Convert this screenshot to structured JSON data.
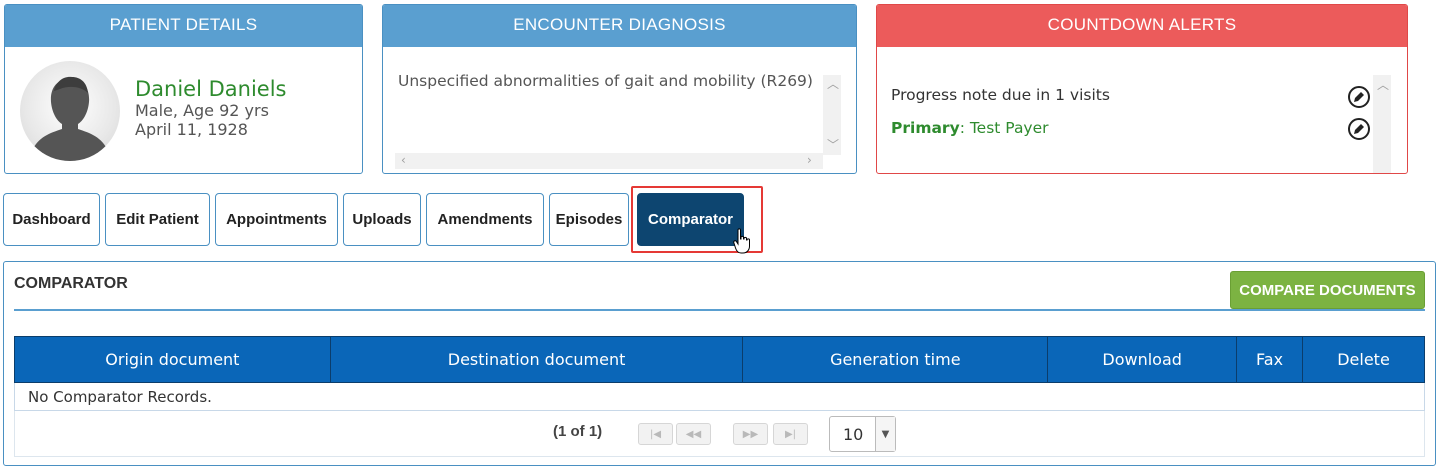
{
  "patient_panel": {
    "title": "PATIENT DETAILS",
    "name": "Daniel Daniels",
    "gender_age": "Male, Age 92 yrs",
    "dob": "April 11, 1928"
  },
  "diagnosis_panel": {
    "title": "ENCOUNTER DIAGNOSIS",
    "diagnosis": "Unspecified abnormalities of gait and mobility (R269)"
  },
  "alerts_panel": {
    "title": "COUNTDOWN ALERTS",
    "alert": "Progress note due in 1 visits",
    "primary_label": "Primary",
    "primary_value": ": Test Payer"
  },
  "tabs": [
    {
      "label": "Dashboard"
    },
    {
      "label": "Edit Patient"
    },
    {
      "label": "Appointments"
    },
    {
      "label": "Uploads"
    },
    {
      "label": "Amendments"
    },
    {
      "label": "Episodes"
    },
    {
      "label": "Comparator",
      "active": true
    }
  ],
  "comparator": {
    "title": "COMPARATOR",
    "compare_button": "COMPARE DOCUMENTS",
    "columns": [
      "Origin document",
      "Destination document",
      "Generation time",
      "Download",
      "Fax",
      "Delete"
    ],
    "empty_message": "No Comparator Records.",
    "pager": {
      "info": "(1 of 1)",
      "rows_per_page": "10"
    }
  },
  "colors": {
    "panel_header_blue": "#5a9fd0",
    "alert_header_red": "#ec5b5b",
    "active_tab": "#0d4570",
    "table_header": "#0a66b8",
    "compare_button": "#7cb342",
    "highlight": "#e53935",
    "patient_name_green": "#2e8b2e"
  }
}
